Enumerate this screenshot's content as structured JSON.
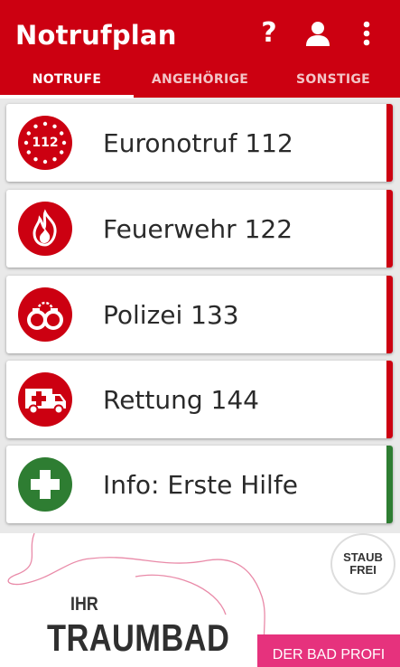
{
  "colors": {
    "primary": "#cc0011",
    "info_green": "#2e7d32"
  },
  "appbar": {
    "title": "Notrufplan",
    "help_icon": "?",
    "icons": [
      "help-icon",
      "person-icon",
      "more-vert-icon"
    ]
  },
  "tabs": [
    {
      "label": "NOTRUFE",
      "active": true
    },
    {
      "label": "ANGEHÖRIGE",
      "active": false
    },
    {
      "label": "SONSTIGE",
      "active": false
    }
  ],
  "cards": [
    {
      "label": "Euronotruf 112",
      "icon": "euro-stars-112-icon",
      "icon_text": "112",
      "accent": "#cc0011"
    },
    {
      "label": "Feuerwehr 122",
      "icon": "fire-icon",
      "accent": "#cc0011"
    },
    {
      "label": "Polizei 133",
      "icon": "handcuffs-icon",
      "accent": "#cc0011"
    },
    {
      "label": "Rettung 144",
      "icon": "ambulance-icon",
      "accent": "#cc0011"
    },
    {
      "label": "Info: Erste Hilfe",
      "icon": "first-aid-cross-icon",
      "accent": "#2e7d32"
    }
  ],
  "ad": {
    "line1": "IHR",
    "line2": "TRAUMBAD",
    "badge_line1": "STAUB",
    "badge_line2": "FREI",
    "brand": "DER BAD PROFI"
  }
}
